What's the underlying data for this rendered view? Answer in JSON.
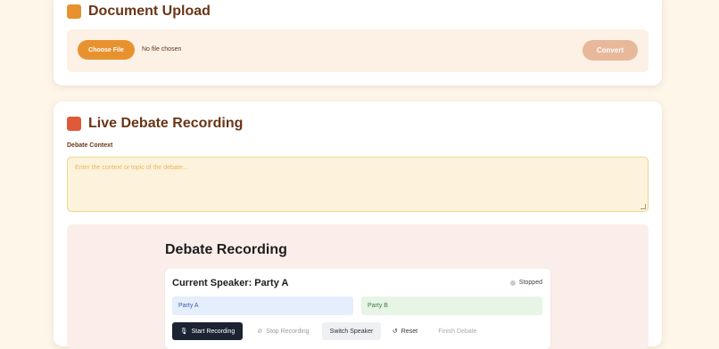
{
  "upload": {
    "title": "Document Upload",
    "accent": "#e8922f",
    "choose_label": "Choose File",
    "no_file": "No file chosen",
    "convert_label": "Convert"
  },
  "debate": {
    "title": "Live Debate Recording",
    "accent": "#e05a3a",
    "context_label": "Debate Context",
    "context_placeholder": "Enter the context or topic of the debate...",
    "recording": {
      "title": "Debate Recording",
      "current_speaker": "Current Speaker: Party A",
      "status": "Stopped",
      "party_a": "Party A",
      "party_b": "Party B",
      "buttons": {
        "start": "Start Recording",
        "stop": "Stop Recording",
        "switch": "Switch Speaker",
        "reset": "Reset",
        "finish": "Finish Debate"
      },
      "icons": {
        "start": "microphone-icon",
        "stop": "microphone-off-icon",
        "reset": "reset-icon"
      }
    }
  }
}
